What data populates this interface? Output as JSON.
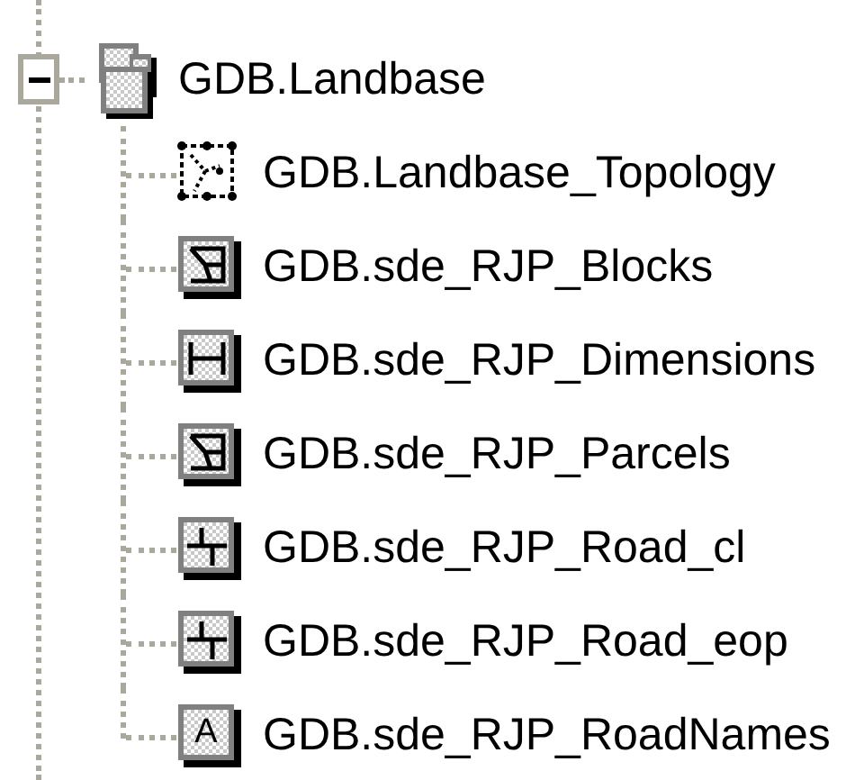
{
  "tree": [
    {
      "label": "GDB.Landbase",
      "kind": "dataset",
      "expanded": true,
      "children": [
        {
          "label": "GDB.Landbase_Topology",
          "kind": "topology"
        },
        {
          "label": "GDB.sde_RJP_Blocks",
          "kind": "polygon"
        },
        {
          "label": "GDB.sde_RJP_Dimensions",
          "kind": "dimension"
        },
        {
          "label": "GDB.sde_RJP_Parcels",
          "kind": "polygon"
        },
        {
          "label": "GDB.sde_RJP_Road_cl",
          "kind": "line"
        },
        {
          "label": "GDB.sde_RJP_Road_eop",
          "kind": "line"
        },
        {
          "label": "GDB.sde_RJP_RoadNames",
          "kind": "annotation",
          "icon_label": "A"
        }
      ]
    }
  ]
}
